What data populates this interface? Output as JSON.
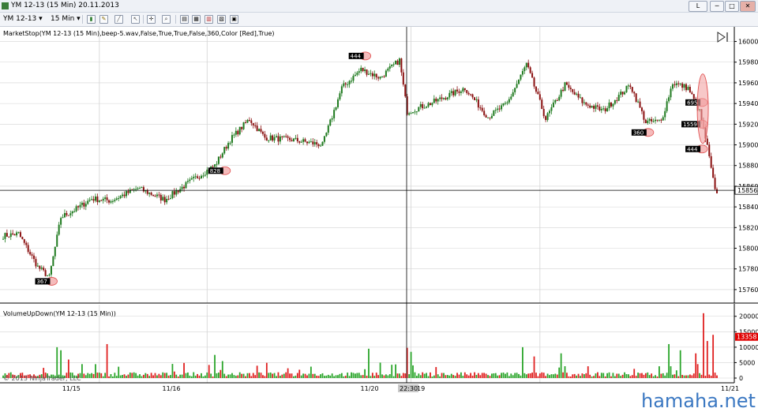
{
  "window": {
    "title": "YM 12-13 (15 Min)  20.11.2013",
    "buttons": [
      "L",
      "─",
      "□",
      "✕"
    ]
  },
  "toolbar": {
    "instrument": "YM 12-13",
    "interval": "15 Min",
    "dropdown_glyph": "▾"
  },
  "copyright": "© 2013 NinjaTrader, LLC",
  "watermark": "hamaha.net",
  "colors": {
    "up_candle": "#1f7a1f",
    "down_candle": "#8a1010",
    "vol_up": "#2aa52a",
    "vol_down": "#e02020",
    "grid": "#d3d3d3",
    "marker_fill": "#f2a4a4",
    "marker_stroke": "#e05050",
    "current_price_box": "#e00000"
  },
  "chart_data": [
    {
      "type": "candlestick",
      "title": "MarketStop(YM 12-13 (15 Min),beep-5.wav,False,True,True,False,360,Color [Red],True)",
      "ylim": [
        15750,
        16005
      ],
      "yticks": [
        16000,
        15980,
        15960,
        15940,
        15920,
        15900,
        15880,
        15860,
        15840,
        15820,
        15800,
        15780,
        15760
      ],
      "x_ticks": [
        "11/15",
        "11/16",
        "22:30",
        "19",
        "11/20",
        "11/21"
      ],
      "crosshair_price": "15856",
      "current_price": "15856",
      "path_keypoints": [
        {
          "bar": 0,
          "price": 15812
        },
        {
          "bar": 8,
          "price": 15814
        },
        {
          "bar": 18,
          "price": 15782
        },
        {
          "bar": 24,
          "price": 15772
        },
        {
          "bar": 30,
          "price": 15830
        },
        {
          "bar": 38,
          "price": 15838
        },
        {
          "bar": 46,
          "price": 15848
        },
        {
          "bar": 56,
          "price": 15846
        },
        {
          "bar": 70,
          "price": 15858
        },
        {
          "bar": 84,
          "price": 15847
        },
        {
          "bar": 100,
          "price": 15868
        },
        {
          "bar": 110,
          "price": 15880
        },
        {
          "bar": 118,
          "price": 15905
        },
        {
          "bar": 128,
          "price": 15925
        },
        {
          "bar": 136,
          "price": 15907
        },
        {
          "bar": 150,
          "price": 15905
        },
        {
          "bar": 166,
          "price": 15900
        },
        {
          "bar": 176,
          "price": 15955
        },
        {
          "bar": 186,
          "price": 15973
        },
        {
          "bar": 196,
          "price": 15965
        },
        {
          "bar": 206,
          "price": 15982
        },
        {
          "bar": 210,
          "price": 15932
        },
        {
          "bar": 222,
          "price": 15940
        },
        {
          "bar": 240,
          "price": 15955
        },
        {
          "bar": 252,
          "price": 15927
        },
        {
          "bar": 262,
          "price": 15940
        },
        {
          "bar": 272,
          "price": 15978
        },
        {
          "bar": 282,
          "price": 15925
        },
        {
          "bar": 292,
          "price": 15958
        },
        {
          "bar": 302,
          "price": 15940
        },
        {
          "bar": 312,
          "price": 15933
        },
        {
          "bar": 326,
          "price": 15958
        },
        {
          "bar": 334,
          "price": 15922
        },
        {
          "bar": 342,
          "price": 15923
        },
        {
          "bar": 348,
          "price": 15960
        },
        {
          "bar": 356,
          "price": 15955
        },
        {
          "bar": 362,
          "price": 15932
        },
        {
          "bar": 366,
          "price": 15898
        },
        {
          "bar": 370,
          "price": 15855
        }
      ],
      "markers": [
        {
          "label": "367",
          "bar": 24,
          "price": 15768
        },
        {
          "label": "828",
          "bar": 114,
          "price": 15875
        },
        {
          "label": "444",
          "bar": 187,
          "price": 15986
        },
        {
          "label": "360",
          "bar": 334,
          "price": 15912
        },
        {
          "label": "695",
          "bar": 362,
          "price": 15941
        },
        {
          "label": "1559",
          "bar": 362,
          "price": 15920
        },
        {
          "label": "444",
          "bar": 362,
          "price": 15896
        }
      ]
    },
    {
      "type": "bar",
      "title": "VolumeUpDown(YM 12-13 (15 Min))",
      "ylim": [
        0,
        23000
      ],
      "yticks": [
        20000,
        15000,
        10000,
        5000,
        0
      ],
      "current_value": "13358",
      "spikes": [
        {
          "bar": 28,
          "value": 10000
        },
        {
          "bar": 30,
          "value": 9000
        },
        {
          "bar": 34,
          "value": 6000
        },
        {
          "bar": 48,
          "value": 4500
        },
        {
          "bar": 54,
          "value": 11000
        },
        {
          "bar": 110,
          "value": 7500
        },
        {
          "bar": 114,
          "value": 5500
        },
        {
          "bar": 132,
          "value": 4000
        },
        {
          "bar": 190,
          "value": 9500
        },
        {
          "bar": 196,
          "value": 5000
        },
        {
          "bar": 210,
          "value": 9800
        },
        {
          "bar": 212,
          "value": 8500
        },
        {
          "bar": 270,
          "value": 10000
        },
        {
          "bar": 276,
          "value": 7000
        },
        {
          "bar": 290,
          "value": 8000
        },
        {
          "bar": 346,
          "value": 11000
        },
        {
          "bar": 352,
          "value": 9000
        },
        {
          "bar": 360,
          "value": 8000
        },
        {
          "bar": 364,
          "value": 21000
        },
        {
          "bar": 366,
          "value": 12000
        },
        {
          "bar": 369,
          "value": 14000
        }
      ]
    }
  ]
}
